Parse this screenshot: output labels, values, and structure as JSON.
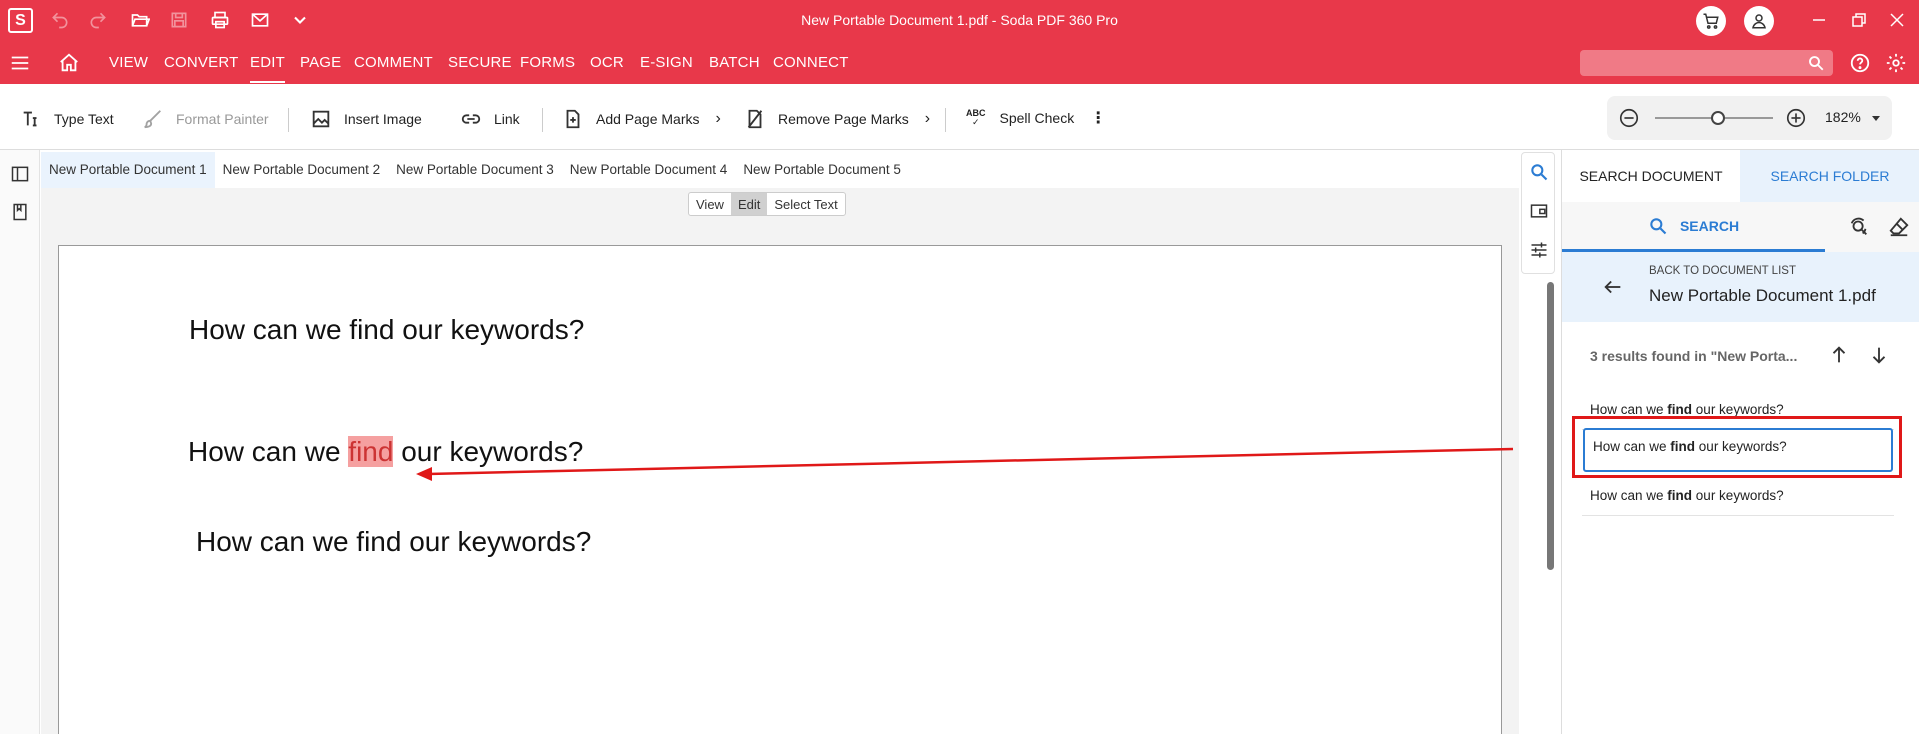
{
  "titlebar": {
    "app_letter": "S",
    "title": "New Portable Document 1.pdf   -   Soda PDF 360 Pro",
    "accent": "#e8384a"
  },
  "menu": {
    "items": [
      "VIEW",
      "CONVERT",
      "EDIT",
      "PAGE",
      "COMMENT",
      "SECURE",
      "FORMS",
      "OCR",
      "E-SIGN",
      "BATCH",
      "CONNECT"
    ],
    "active": "EDIT"
  },
  "toolbar": {
    "type_text": "Type Text",
    "format_painter": "Format Painter",
    "insert_image": "Insert Image",
    "link": "Link",
    "add_page_marks": "Add Page Marks",
    "remove_page_marks": "Remove Page Marks",
    "spell_check": "Spell Check",
    "spell_check_icon_text": "ABC"
  },
  "zoom": {
    "value": "182%",
    "level_fraction": 0.5
  },
  "doc_tabs": [
    "New Portable Document 1",
    "New Portable Document 2",
    "New Portable Document 3",
    "New Portable Document 4",
    "New Portable Document 5"
  ],
  "mode_switch": {
    "view": "View",
    "edit": "Edit",
    "select_text": "Select Text"
  },
  "page": {
    "line1": "How can we find our keywords?",
    "line2_before": "How can we ",
    "line2_match": "find",
    "line2_after": " our keywords?",
    "line3": "How can we find our keywords?"
  },
  "search_panel": {
    "tab_document": "SEARCH DOCUMENT",
    "tab_folder": "SEARCH FOLDER",
    "search_label": "SEARCH",
    "back_caption": "BACK TO DOCUMENT LIST",
    "back_file": "New Portable Document 1.pdf",
    "results_count": "3 results found in \"New Porta...",
    "results": [
      {
        "before": "How can we ",
        "match": "find",
        "after": " our keywords?"
      },
      {
        "before": "How can we ",
        "match": "find",
        "after": " our keywords?"
      },
      {
        "before": "How can we ",
        "match": "find",
        "after": " our keywords?"
      }
    ]
  }
}
